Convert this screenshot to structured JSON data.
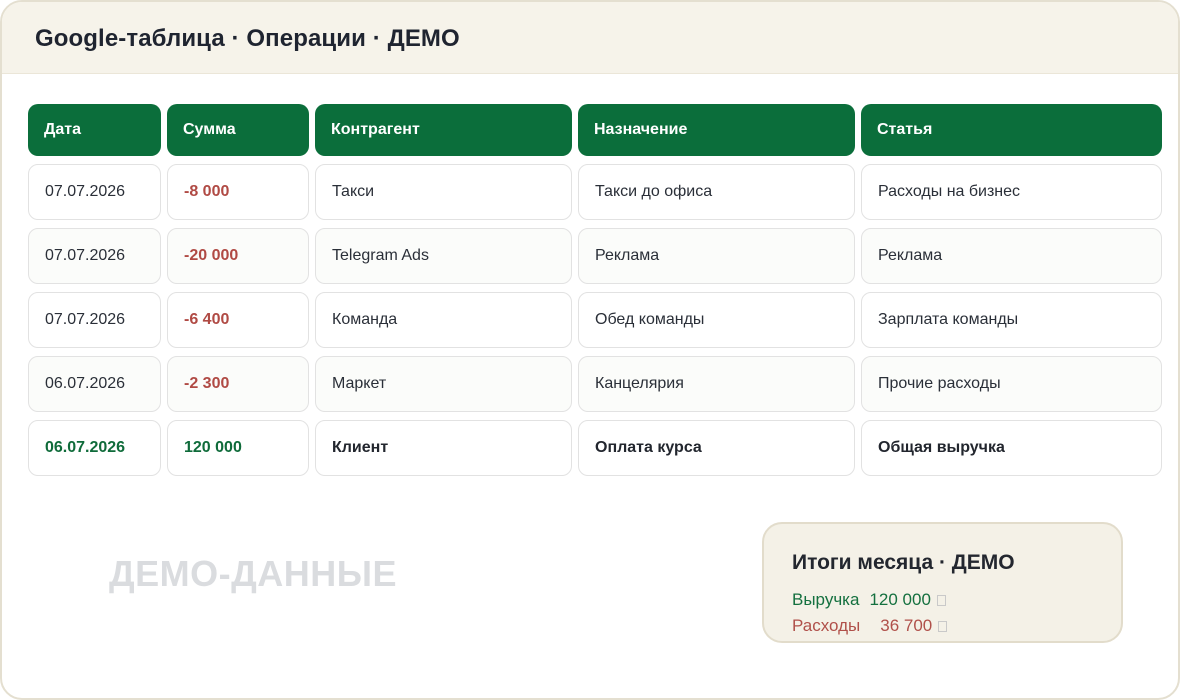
{
  "window": {
    "title": "Google-таблица · Операции · ДЕМО"
  },
  "table": {
    "headers": [
      "Дата",
      "Сумма",
      "Контрагент",
      "Назначение",
      "Статья"
    ],
    "rows": [
      {
        "date": "07.07.2026",
        "amount": "-8 000",
        "counterparty": "Такси",
        "purpose": "Такси до офиса",
        "category": "Расходы на бизнес",
        "kind": "expense"
      },
      {
        "date": "07.07.2026",
        "amount": "-20 000",
        "counterparty": "Telegram Ads",
        "purpose": "Реклама",
        "category": "Реклама",
        "kind": "expense"
      },
      {
        "date": "07.07.2026",
        "amount": "-6 400",
        "counterparty": "Команда",
        "purpose": "Обед команды",
        "category": "Зарплата команды",
        "kind": "expense"
      },
      {
        "date": "06.07.2026",
        "amount": "-2 300",
        "counterparty": "Маркет",
        "purpose": "Канцелярия",
        "category": "Прочие расходы",
        "kind": "expense"
      },
      {
        "date": "06.07.2026",
        "amount": "120 000",
        "counterparty": "Клиент",
        "purpose": "Оплата курса",
        "category": "Общая выручка",
        "kind": "income"
      }
    ]
  },
  "watermark": "ДЕМО-ДАННЫЕ",
  "summary": {
    "title": "Итоги месяца · ДЕМО",
    "revenue_label": "Выручка",
    "revenue_value": "120 000",
    "expenses_label": "Расходы",
    "expenses_value": "36 700",
    "value_icon": "box-icon"
  },
  "colors": {
    "header_green": "#0b6e3b",
    "income_green": "#0f6b3a",
    "expense_red": "#b04a44",
    "titlebar_bg": "#f6f3ea",
    "summary_bg": "#f4f1e7"
  }
}
